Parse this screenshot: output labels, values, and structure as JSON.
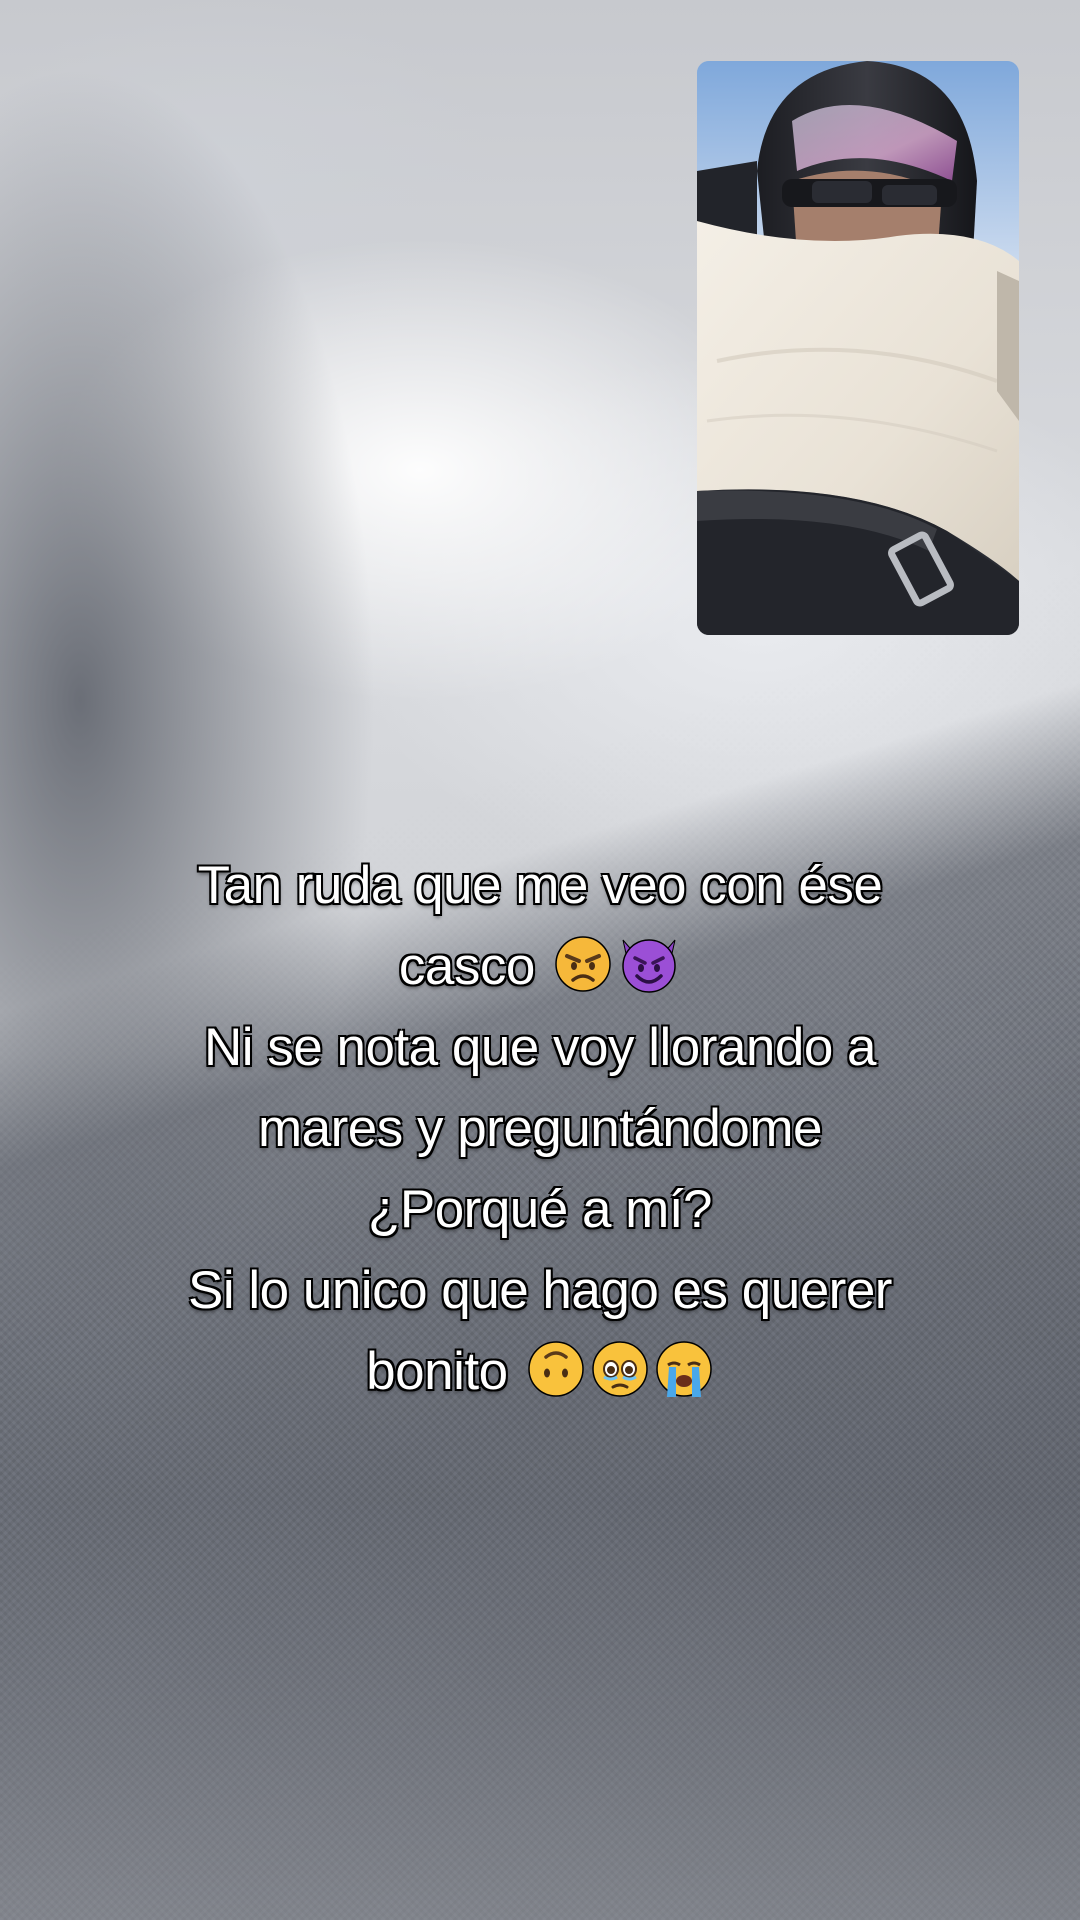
{
  "caption": {
    "lines": [
      "Tan ruda que me veo con ése",
      "casco",
      "Ni se nota que voy llorando a",
      "mares y preguntándome",
      "¿Porqué a mí?",
      "Si lo unico que hago es querer",
      "bonito"
    ],
    "emojis": {
      "line_casco": [
        "angry-face-emoji",
        "smiling-face-with-horns-emoji"
      ],
      "line_bonito": [
        "upside-down-face-emoji",
        "face-holding-back-tears-emoji",
        "loudly-crying-face-emoji"
      ]
    },
    "text_color": "#ffffff",
    "outline_color": "#000000"
  },
  "self_view": {
    "description_icon": "self-camera-preview"
  }
}
